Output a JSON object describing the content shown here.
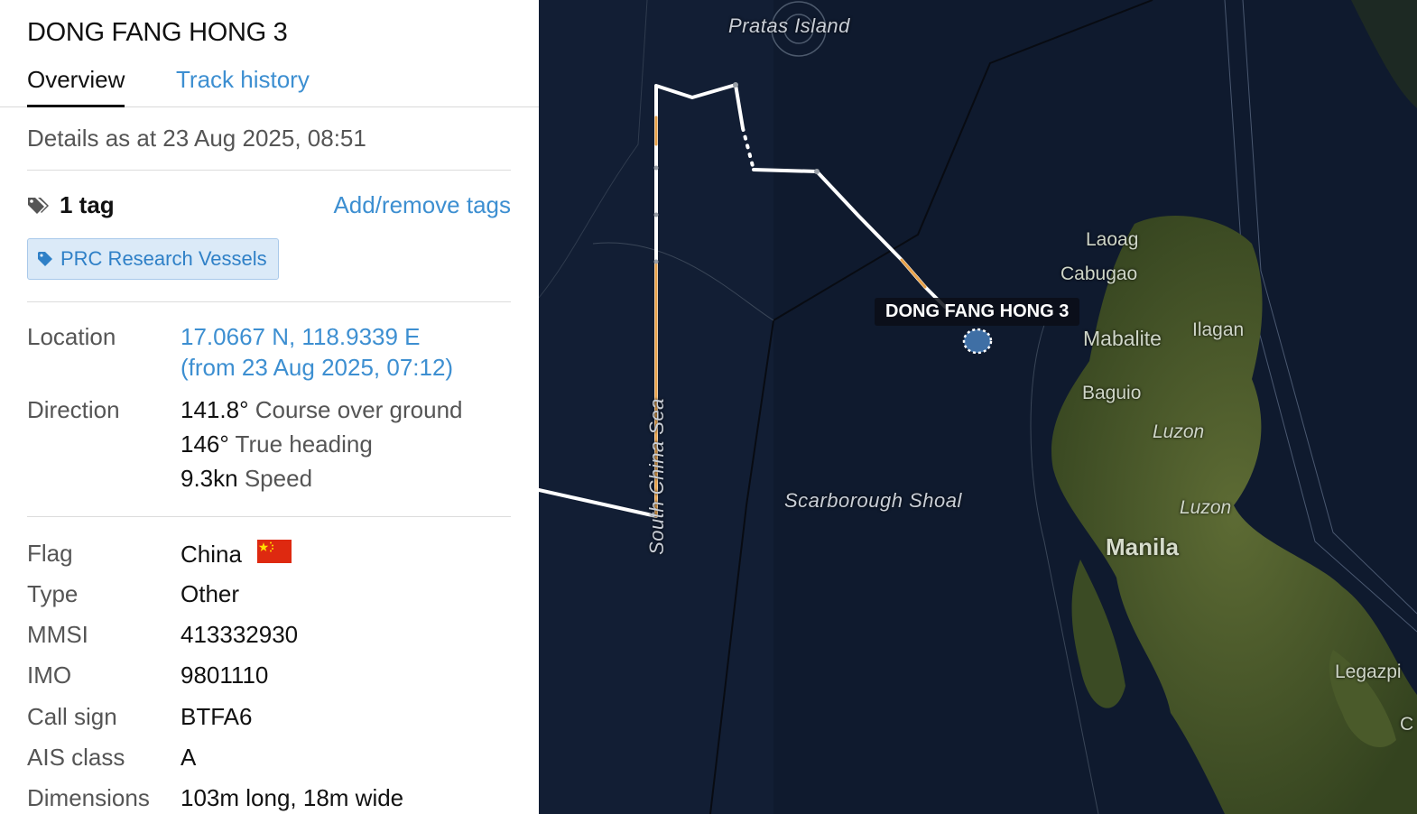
{
  "vessel": {
    "name": "DONG FANG HONG 3"
  },
  "tabs": [
    {
      "label": "Overview",
      "active": true
    },
    {
      "label": "Track history",
      "active": false
    }
  ],
  "details_as_at": "Details as at 23 Aug 2025, 08:51",
  "tags": {
    "count_label": "1 tag",
    "add_remove_label": "Add/remove tags",
    "items": [
      "PRC Research Vessels"
    ],
    "icon": "tags-icon"
  },
  "location": {
    "label": "Location",
    "coords": "17.0667 N, 118.9339 E",
    "since": "(from 23 Aug 2025, 07:12)"
  },
  "direction": {
    "label": "Direction",
    "cog_value": "141.8°",
    "cog_label": "Course over ground",
    "heading_value": "146°",
    "heading_label": "True heading",
    "speed_value": "9.3kn",
    "speed_label": "Speed"
  },
  "details": [
    {
      "label": "Flag",
      "value": "China"
    },
    {
      "label": "Type",
      "value": "Other"
    },
    {
      "label": "MMSI",
      "value": "413332930"
    },
    {
      "label": "IMO",
      "value": "9801110"
    },
    {
      "label": "Call sign",
      "value": "BTFA6"
    },
    {
      "label": "AIS class",
      "value": "A"
    },
    {
      "label": "Dimensions",
      "value": "103m long, 18m wide"
    }
  ],
  "map": {
    "labels": {
      "pratas": "Pratas Island",
      "scs": "South China Sea",
      "scarborough": "Scarborough Shoal",
      "vessel_label": "DONG FANG HONG 3"
    },
    "places": [
      "Laoag",
      "Cabugao",
      "Mabalite",
      "Ilagan",
      "Baguio",
      "Luzon",
      "Luzon",
      "Manila",
      "Legazpi",
      "C"
    ],
    "colors": {
      "ocean": "#0f1a2e",
      "track": "#ffffff",
      "track_alt": "#e8a24a",
      "link": "#3d8fd1",
      "chip_bg": "#dbeaf8"
    }
  }
}
